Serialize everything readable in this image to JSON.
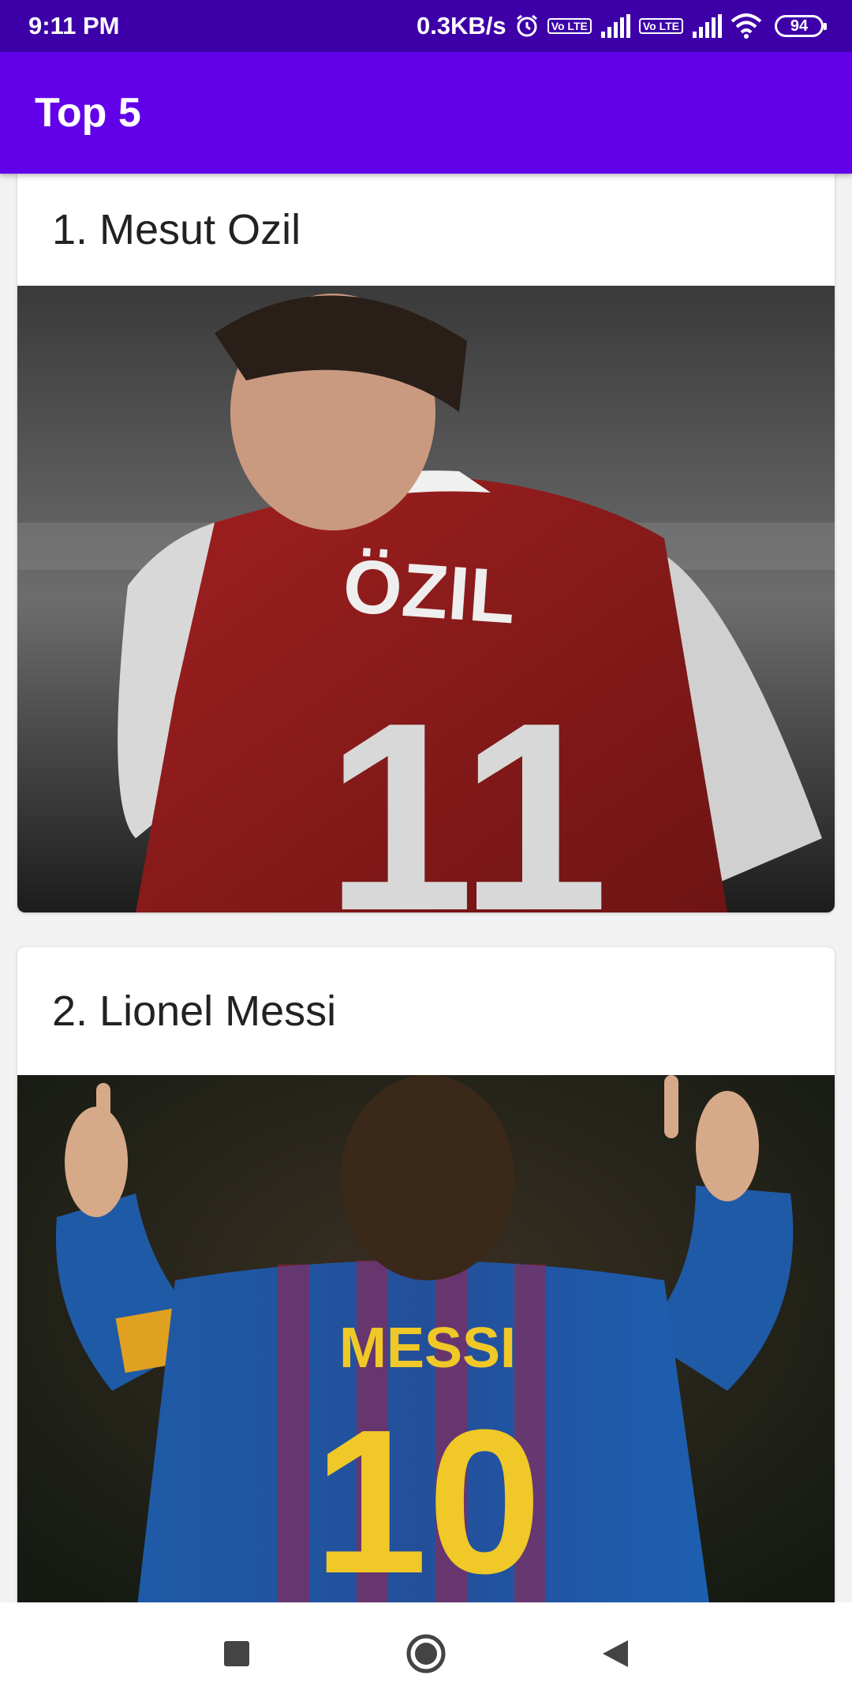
{
  "status_bar": {
    "time": "9:11 PM",
    "speed": "0.3KB/s",
    "volte1": "Vo LTE",
    "volte2": "Vo LTE",
    "battery": "94",
    "icons": [
      "alarm-icon",
      "volte-icon",
      "signal-icon",
      "volte-icon",
      "signal-icon",
      "wifi-icon",
      "battery-icon"
    ]
  },
  "app_bar": {
    "title": "Top 5"
  },
  "cards": [
    {
      "title": "1. Mesut Ozil",
      "image": "player-photo-ozil",
      "jersey_name": "ÖZIL",
      "jersey_number": "11"
    },
    {
      "title": "2. Lionel Messi",
      "image": "player-photo-messi",
      "jersey_name": "MESSI",
      "jersey_number": "10"
    }
  ],
  "nav_bar": {
    "icons": [
      "recents-square-icon",
      "home-circle-icon",
      "back-triangle-icon"
    ]
  },
  "colors": {
    "status_bar": "#3d00a8",
    "app_bar": "#6200ea",
    "card_bg": "#ffffff",
    "page_bg": "#f2f2f2"
  }
}
